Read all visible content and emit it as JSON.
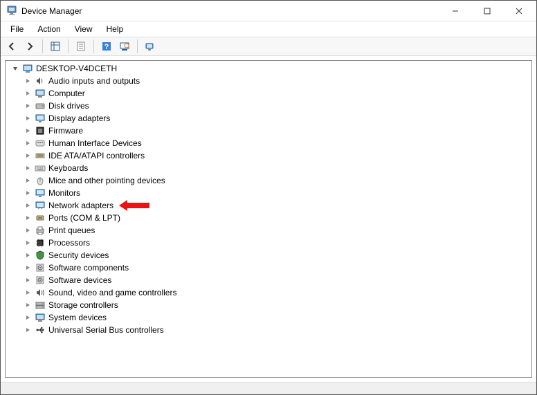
{
  "window": {
    "title": "Device Manager"
  },
  "menus": {
    "file": "File",
    "action": "Action",
    "view": "View",
    "help": "Help"
  },
  "tree": {
    "root": "DESKTOP-V4DCETH",
    "items": [
      "Audio inputs and outputs",
      "Computer",
      "Disk drives",
      "Display adapters",
      "Firmware",
      "Human Interface Devices",
      "IDE ATA/ATAPI controllers",
      "Keyboards",
      "Mice and other pointing devices",
      "Monitors",
      "Network adapters",
      "Ports (COM & LPT)",
      "Print queues",
      "Processors",
      "Security devices",
      "Software components",
      "Software devices",
      "Sound, video and game controllers",
      "Storage controllers",
      "System devices",
      "Universal Serial Bus controllers"
    ]
  },
  "annotation": {
    "highlighted_index": 10
  }
}
